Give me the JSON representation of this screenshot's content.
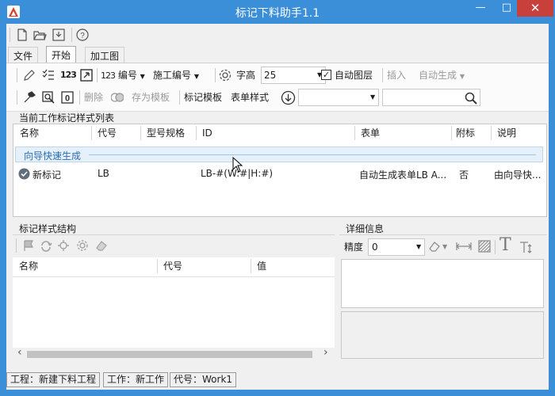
{
  "window": {
    "title": "标记下料助手1.1",
    "minimize": "—",
    "maximize": "□",
    "close": "✕"
  },
  "quick_toolbar": {
    "icons": [
      "new-file-icon",
      "open-folder-icon",
      "save-icon",
      "help-icon"
    ]
  },
  "tabs": [
    {
      "label": "文件",
      "active": false
    },
    {
      "label": "开始",
      "active": true
    },
    {
      "label": "加工图",
      "active": false
    }
  ],
  "ribbon": {
    "row1": {
      "numbering_label": "编号",
      "construction_numbering_label": "施工编号",
      "font_height_label": "字高",
      "font_height_value": "25",
      "auto_layer_label": "自动图层",
      "auto_layer_checked": true,
      "insert_label": "插入",
      "auto_generate_label": "自动生成"
    },
    "row2": {
      "delete_label": "删除",
      "save_template_label": "存为模板",
      "mark_template_label": "标记模板",
      "form_style_label": "表单样式",
      "combo_value": "",
      "search_value": ""
    }
  },
  "style_list": {
    "title": "当前工作标记样式列表",
    "columns": [
      "名称",
      "代号",
      "型号规格",
      "ID",
      "表单",
      "附标",
      "说明"
    ],
    "group_label": "向导快速生成",
    "rows": [
      {
        "name": "新标记",
        "code": "LB",
        "model": "",
        "id": "LB-#(W:#|H:#)",
        "form": "自动生成表单LB A...",
        "attached": "否",
        "desc": "由向导快..."
      }
    ]
  },
  "structure": {
    "title": "标记样式结构",
    "columns": [
      "名称",
      "代号",
      "值"
    ],
    "scroll_left": "‹",
    "scroll_right": "›"
  },
  "details": {
    "title": "详细信息",
    "precision_label": "精度",
    "precision_value": "0"
  },
  "statusbar": {
    "project": "工程：新建下料工程",
    "work": "工作：新工作",
    "code": "代号：Work1"
  },
  "colors": {
    "titlebar": "#3a8fd8",
    "close": "#c7413a",
    "group_bg": "#e6f0fa",
    "group_text": "#2a6db5"
  }
}
